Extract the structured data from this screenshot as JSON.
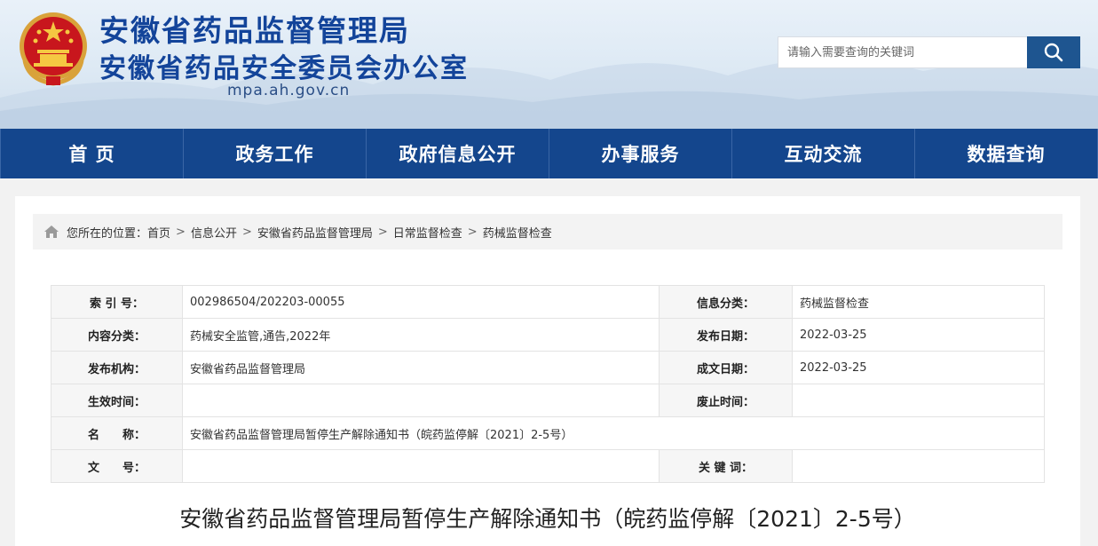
{
  "header": {
    "title_line1": "安徽省药品监督管理局",
    "title_line2": "安徽省药品安全委员会办公室",
    "domain": "mpa.ah.gov.cn",
    "emblem_icon": "national-emblem-icon"
  },
  "search": {
    "placeholder": "请输入需要查询的关键词",
    "button_icon": "search-icon"
  },
  "nav": {
    "items": [
      {
        "label": "首 页"
      },
      {
        "label": "政务工作"
      },
      {
        "label": "政府信息公开"
      },
      {
        "label": "办事服务"
      },
      {
        "label": "互动交流"
      },
      {
        "label": "数据查询"
      }
    ]
  },
  "breadcrumb": {
    "prefix": "您所在的位置：",
    "items": [
      "首页",
      "信息公开",
      "安徽省药品监督管理局",
      "日常监督检查",
      "药械监督检查"
    ],
    "separator": ">"
  },
  "meta": {
    "index_label": "索 引 号：",
    "index_value": "002986504/202203-00055",
    "category_label": "信息分类：",
    "category_value": "药械监督检查",
    "content_label": "内容分类：",
    "content_value": "药械安全监管,通告,2022年",
    "publish_date_label": "发布日期：",
    "publish_date_value": "2022-03-25",
    "org_label": "发布机构：",
    "org_value": "安徽省药品监督管理局",
    "written_date_label": "成文日期：",
    "written_date_value": "2022-03-25",
    "effective_label": "生效时间：",
    "effective_value": "",
    "repeal_label": "废止时间：",
    "repeal_value": "",
    "name_label": "名　　称：",
    "name_value": "安徽省药品监督管理局暂停生产解除通知书（皖药监停解〔2021〕2-5号）",
    "docno_label": "文　　号：",
    "docno_value": "",
    "keywords_label": "关 键 词：",
    "keywords_value": ""
  },
  "document": {
    "title": "安徽省药品监督管理局暂停生产解除通知书（皖药监停解〔2021〕2-5号）"
  },
  "colors": {
    "brand_blue": "#14468d",
    "title_blue": "#13449a",
    "search_button": "#1e5590"
  }
}
